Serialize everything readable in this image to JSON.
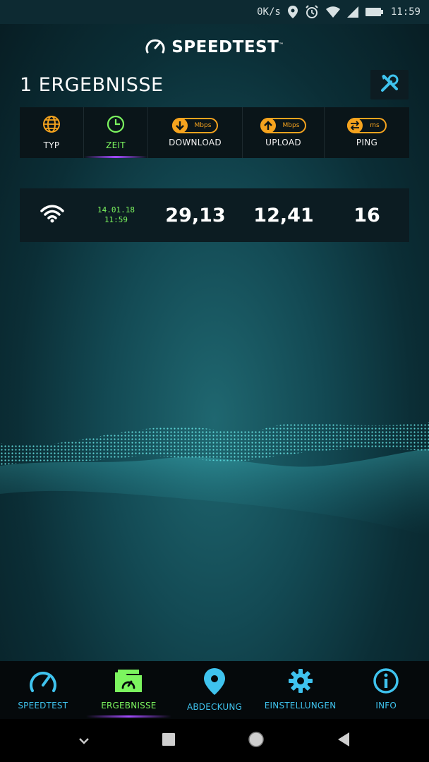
{
  "status_bar": {
    "net_speed": "0K/s",
    "time": "11:59"
  },
  "header": {
    "app_name": "SPEEDTEST",
    "trademark": "™"
  },
  "results": {
    "title": "1 ERGEBNISSE"
  },
  "columns": [
    {
      "label": "TYP",
      "icon": "globe-icon"
    },
    {
      "label": "ZEIT",
      "icon": "clock-icon"
    },
    {
      "label": "DOWNLOAD",
      "icon": "download-arrow-icon",
      "unit": "Mbps"
    },
    {
      "label": "UPLOAD",
      "icon": "upload-arrow-icon",
      "unit": "Mbps"
    },
    {
      "label": "PING",
      "icon": "ping-arrows-icon",
      "unit": "ms"
    }
  ],
  "rows": [
    {
      "type_icon": "wifi-icon",
      "date": "14.01.18",
      "time": "11:59",
      "download": "29,13",
      "upload": "12,41",
      "ping": "16"
    }
  ],
  "bottom_nav": [
    {
      "label": "SPEEDTEST",
      "icon": "speedometer-icon"
    },
    {
      "label": "ERGEBNISSE",
      "icon": "results-folder-icon",
      "active": true
    },
    {
      "label": "ABDECKUNG",
      "icon": "map-pin-icon"
    },
    {
      "label": "EINSTELLUNGEN",
      "icon": "gear-icon"
    },
    {
      "label": "INFO",
      "icon": "info-icon"
    }
  ],
  "colors": {
    "accent_green": "#7cf55f",
    "accent_orange": "#f5a31e",
    "accent_blue": "#3fc3ee",
    "accent_purple": "#a34bff"
  }
}
